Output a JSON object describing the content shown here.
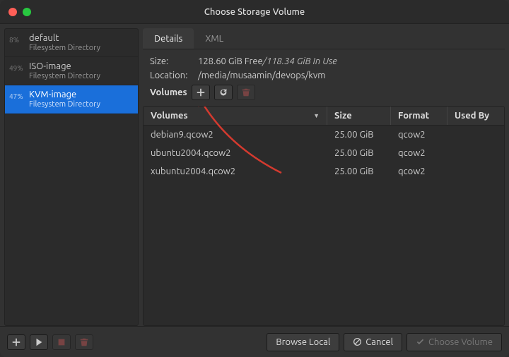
{
  "window": {
    "title": "Choose Storage Volume"
  },
  "sidebar": {
    "pools": [
      {
        "pct": "8%",
        "name": "default",
        "sub": "Filesystem Directory",
        "selected": false
      },
      {
        "pct": "49%",
        "name": "ISO-image",
        "sub": "Filesystem Directory",
        "selected": false
      },
      {
        "pct": "47%",
        "name": "KVM-image",
        "sub": "Filesystem Directory",
        "selected": true
      }
    ]
  },
  "tabs": [
    {
      "label": "Details",
      "active": true
    },
    {
      "label": "XML",
      "active": false
    }
  ],
  "details": {
    "size_label": "Size:",
    "size_free": "128.60 GiB Free",
    "size_sep": " / ",
    "size_inuse": "118.34 GiB In Use",
    "location_label": "Location:",
    "location_value": "/media/musaamin/devops/kvm",
    "volumes_label": "Volumes"
  },
  "vol_buttons": {
    "add": "plus-icon",
    "refresh": "refresh-icon",
    "delete": "trash-icon"
  },
  "table": {
    "columns": {
      "volumes": "Volumes",
      "size": "Size",
      "format": "Format",
      "used_by": "Used By"
    },
    "rows": [
      {
        "name": "debian9.qcow2",
        "size": "25.00 GiB",
        "format": "qcow2",
        "used_by": ""
      },
      {
        "name": "ubuntu2004.qcow2",
        "size": "25.00 GiB",
        "format": "qcow2",
        "used_by": ""
      },
      {
        "name": "xubuntu2004.qcow2",
        "size": "25.00 GiB",
        "format": "qcow2",
        "used_by": ""
      }
    ]
  },
  "footer": {
    "browse_local": "Browse Local",
    "cancel": "Cancel",
    "choose": "Choose Volume"
  },
  "colors": {
    "accent": "#1a6fda",
    "annot": "#d43a2f"
  }
}
